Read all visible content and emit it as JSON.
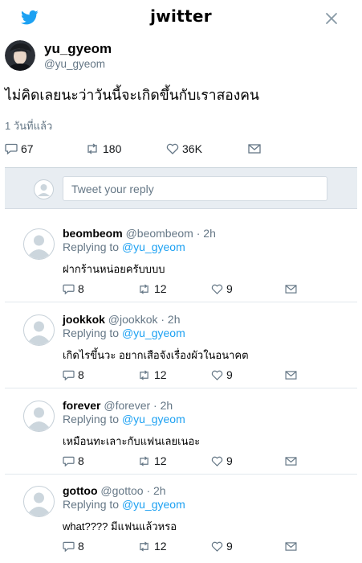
{
  "app": {
    "brand": "jwitter"
  },
  "tweet": {
    "author_name": "yu_gyeom",
    "author_handle": "@yu_gyeom",
    "text": "ไม่คิดเลยนะว่าวันนี้จะเกิดขึ้นกับเราสองคน",
    "time": "1 วันที่แล้ว",
    "stats": {
      "replies": "67",
      "retweets": "180",
      "likes": "36K"
    }
  },
  "reply_box": {
    "placeholder": "Tweet your reply"
  },
  "replies": [
    {
      "name": "beombeom",
      "handle": "@beombeom",
      "time": "· 2h",
      "replying_label": "Replying to",
      "replying_to": "@yu_gyeom",
      "text": "ฝากร้านหน่อยครับบบบ",
      "replies": "8",
      "retweets": "12",
      "likes": "9"
    },
    {
      "name": "jookkok",
      "handle": "@jookkok",
      "time": "· 2h",
      "replying_label": "Replying to",
      "replying_to": "@yu_gyeom",
      "text": "เกิดไรขึ้นวะ อยากเสือจังเรื่องผัวในอนาคต",
      "replies": "8",
      "retweets": "12",
      "likes": "9"
    },
    {
      "name": "forever",
      "handle": "@forever",
      "time": "· 2h",
      "replying_label": "Replying to",
      "replying_to": "@yu_gyeom",
      "text": "เหมือนทะเลาะกับแฟนเลยเนอะ",
      "replies": "8",
      "retweets": "12",
      "likes": "9"
    },
    {
      "name": "gottoo",
      "handle": "@gottoo",
      "time": "· 2h",
      "replying_label": "Replying to",
      "replying_to": "@yu_gyeom",
      "text": "what???? มีแฟนแล้วหรอ",
      "replies": "8",
      "retweets": "12",
      "likes": "9"
    }
  ],
  "colors": {
    "accent": "#1da1f2",
    "muted": "#657786",
    "reply_box_bg": "#e8edf2"
  }
}
